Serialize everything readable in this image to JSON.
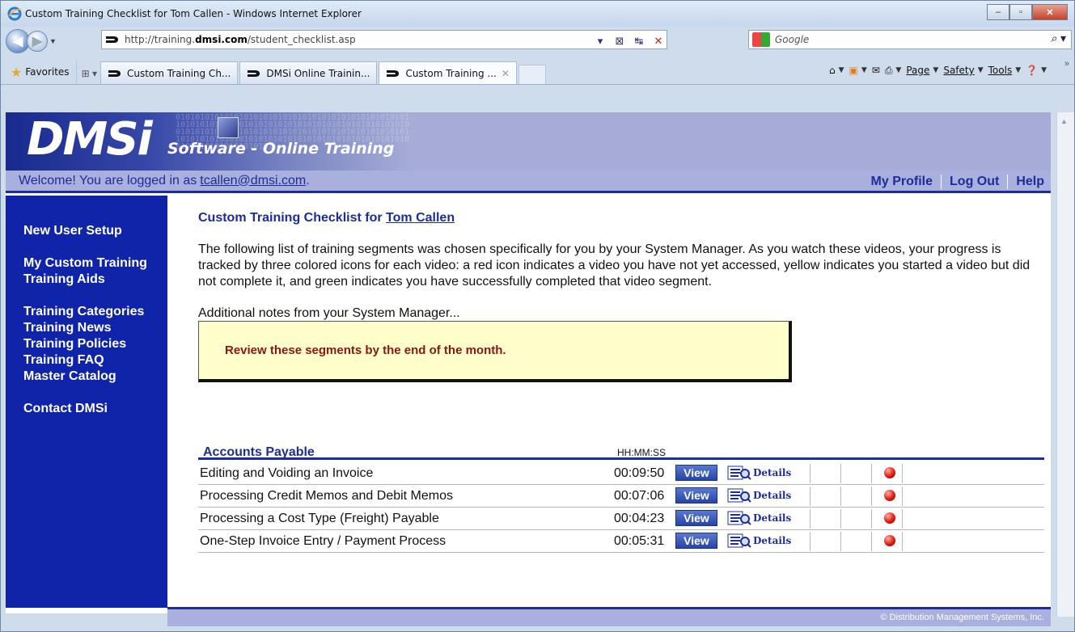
{
  "window": {
    "title": "Custom Training Checklist for Tom Callen - Windows Internet Explorer",
    "buttons": {
      "minimize": "–",
      "maximize": "▫",
      "close": "✕"
    }
  },
  "addressbar": {
    "url_prefix": "http://training.",
    "url_domain": "dmsi.com",
    "url_path": "/student_checklist.asp",
    "search_placeholder": "Google"
  },
  "tabbar": {
    "favorites": "Favorites",
    "tabs": [
      {
        "label": "Custom Training Ch..."
      },
      {
        "label": "DMSi Online Trainin..."
      },
      {
        "label": "Custom Training ...",
        "close": "✕"
      }
    ],
    "commands": {
      "page": "Page",
      "safety": "Safety",
      "tools": "Tools"
    }
  },
  "banner": {
    "logo": "DMSi",
    "tagline_a": "Software",
    "tagline_dash": " - ",
    "tagline_b": "Online Training",
    "bits": "010101010101010101010101010101010101010101010101010101010101010101010101010101010101010101010101010101010101010101010101010101010101010101010101010101010101010101010101010101010101010101010101010101010101010101010101"
  },
  "welcome": {
    "text": "Welcome! You are logged in as",
    "email": "tcallen@dmsi.com",
    "period": ".",
    "links": {
      "profile": "My Profile",
      "logout": "Log Out",
      "help": "Help"
    }
  },
  "sidebar": {
    "new_user_setup": "New User Setup",
    "my_custom_training": "My Custom Training",
    "training_aids": "Training Aids",
    "training_categories": "Training Categories",
    "training_news": "Training News",
    "training_policies": "Training Policies",
    "training_faq": "Training FAQ",
    "master_catalog": "Master Catalog",
    "contact": "Contact DMSi"
  },
  "content": {
    "heading_prefix": "Custom Training Checklist for",
    "heading_name": "Tom Callen",
    "intro": "The following list of training segments was chosen specifically for you by your System Manager. As you watch these videos, your progress is tracked by three colored icons for each video: a red icon indicates a video you have not yet accessed, yellow indicates you started a video but did not complete it, and green indicates you have successfully completed that video segment.",
    "notes_label": "Additional notes from your System Manager...",
    "note": "Review these segments by the end of the month."
  },
  "table": {
    "category": "Accounts Payable",
    "time_header": "HH:MM:SS",
    "view_label": "View",
    "details_label": "Details",
    "rows": [
      {
        "title": "Editing and Voiding an Invoice",
        "time": "00:09:50",
        "status": "not-accessed"
      },
      {
        "title": "Processing Credit Memos and Debit Memos",
        "time": "00:07:06",
        "status": "not-accessed"
      },
      {
        "title": "Processing a Cost Type (Freight) Payable",
        "time": "00:04:23",
        "status": "not-accessed"
      },
      {
        "title": "One-Step Invoice Entry / Payment Process",
        "time": "00:05:31",
        "status": "not-accessed"
      }
    ]
  },
  "footer": {
    "copyright": "© Distribution Management Systems, Inc."
  },
  "colors": {
    "brand_blue": "#0f24a8",
    "band": "#a9b0dd",
    "note_bg": "#ffffcc",
    "note_text": "#8b1414",
    "status_red": "#e21a10"
  }
}
